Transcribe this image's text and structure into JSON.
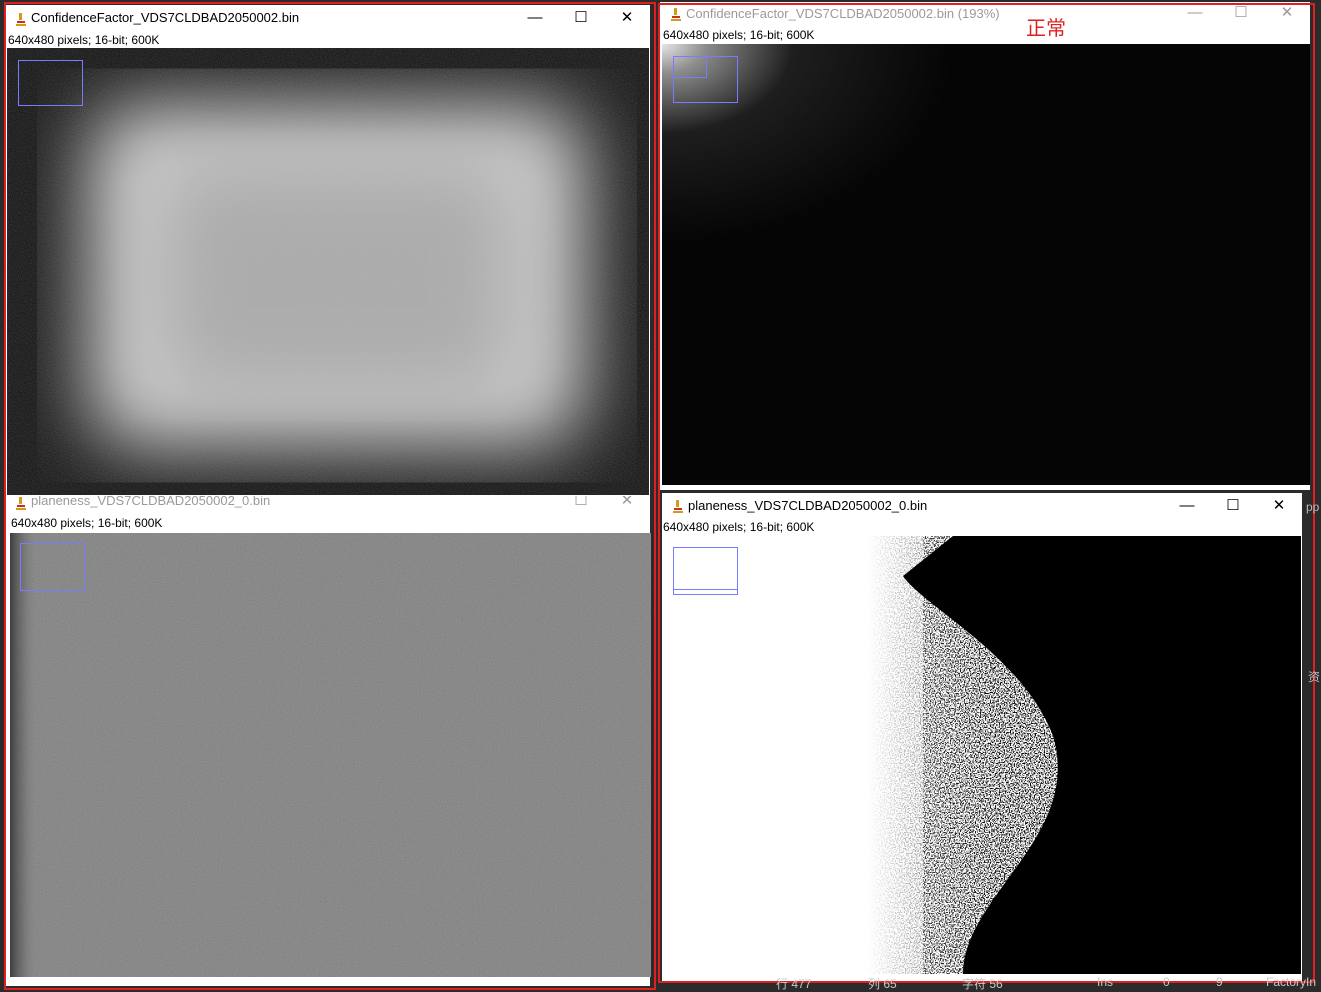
{
  "windows": [
    {
      "title": "ConfidenceFactor_VDS7CLDBAD2050002.bin",
      "info": "640x480 pixels; 16-bit; 600K",
      "active": true
    },
    {
      "title": "ConfidenceFactor_VDS7CLDBAD2050002.bin (193%)",
      "info": "640x480 pixels; 16-bit; 600K",
      "active": false
    },
    {
      "title": "planeness_VDS7CLDBAD2050002_0.bin",
      "info": "640x480 pixels; 16-bit; 600K",
      "active": false
    },
    {
      "title": "planeness_VDS7CLDBAD2050002_0.bin",
      "info": "640x480 pixels; 16-bit; 600K",
      "active": true
    }
  ],
  "window_controls": {
    "minimize": "—",
    "maximize": "☐",
    "close": "✕"
  },
  "annotation": {
    "label": "正常",
    "color": "#e02020"
  },
  "statusbar": {
    "items": [
      "行 477",
      "列 65",
      "字符 56",
      "Ins",
      "0",
      "9",
      "FactoryIn"
    ]
  },
  "side_fragments": [
    "pp",
    "资"
  ],
  "icons": {
    "app": "imagej-microscope-icon",
    "minimize": "minimize-icon",
    "maximize": "maximize-icon",
    "close": "close-icon"
  }
}
